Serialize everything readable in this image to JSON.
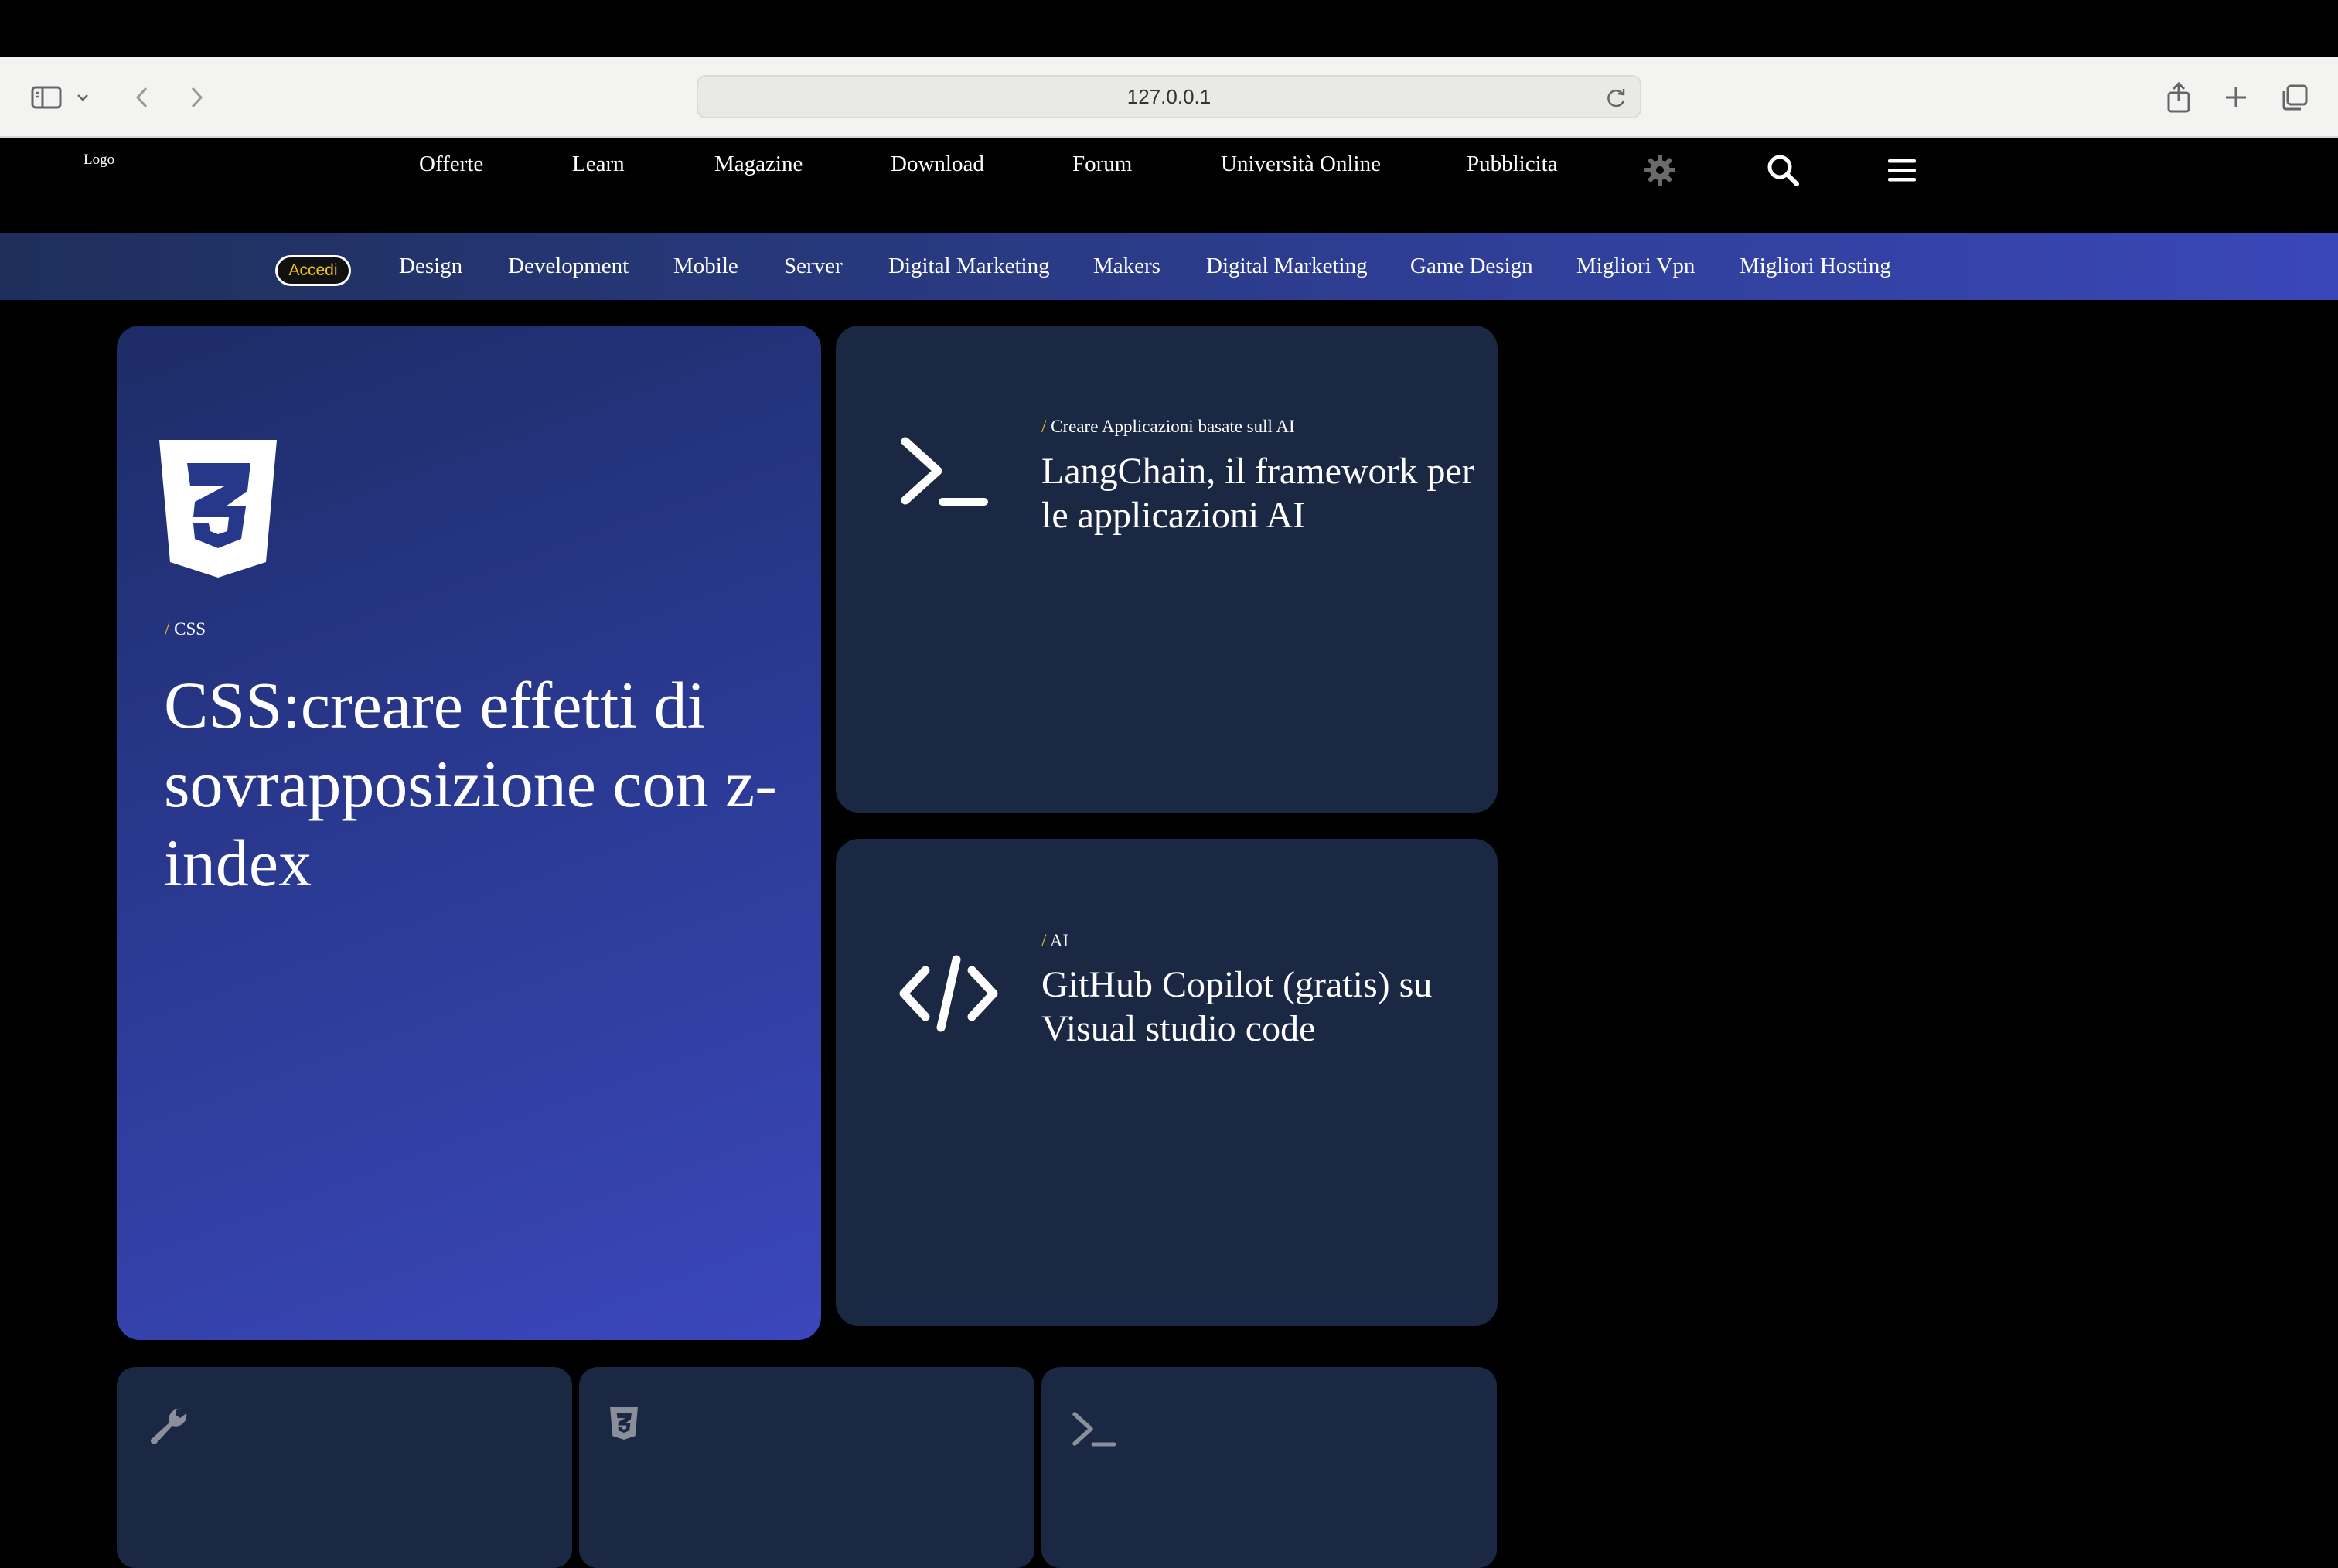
{
  "browser": {
    "url": "127.0.0.1"
  },
  "site": {
    "logo_text": "Logo",
    "nav": [
      {
        "label": "Offerte"
      },
      {
        "label": "Learn"
      },
      {
        "label": "Magazine"
      },
      {
        "label": "Download"
      },
      {
        "label": "Forum"
      },
      {
        "label": "Università Online"
      },
      {
        "label": "Pubblicita"
      }
    ],
    "header_icons": [
      "gear-icon",
      "search-icon",
      "menu-icon"
    ]
  },
  "categories": {
    "login_label": "Accedi",
    "items": [
      {
        "label": "Design"
      },
      {
        "label": "Development"
      },
      {
        "label": "Mobile"
      },
      {
        "label": "Server"
      },
      {
        "label": "Digital Marketing"
      },
      {
        "label": "Makers"
      },
      {
        "label": "Digital Marketing"
      },
      {
        "label": "Game Design"
      },
      {
        "label": "Migliori Vpn"
      },
      {
        "label": "Migliori Hosting"
      }
    ]
  },
  "featured": {
    "icon": "css3-icon",
    "category": "CSS",
    "title": "CSS:creare effetti di sovrapposizione con z-index"
  },
  "cards": [
    {
      "icon": "terminal-icon",
      "category": "Creare Applicazioni basate sull AI",
      "title": "LangChain, il framework per le applicazioni AI"
    },
    {
      "icon": "code-icon",
      "category": "AI",
      "title": "GitHub Copilot (gratis) su Visual studio code"
    }
  ],
  "small_cards": [
    {
      "icon": "wrench-icon"
    },
    {
      "icon": "css3-icon"
    },
    {
      "icon": "terminal-icon"
    }
  ],
  "colors": {
    "accent": "#f0c419",
    "card_dark": "#1b2843",
    "card_blue": "#3b47bb"
  }
}
